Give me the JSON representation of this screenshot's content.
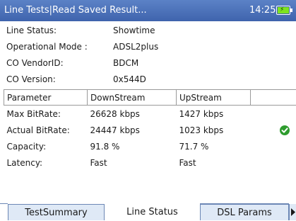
{
  "header": {
    "title": "Line Tests|Read Saved Result...",
    "time": "14:25",
    "icon": "battery-charging-icon"
  },
  "info": [
    {
      "label": "Line Status:",
      "value": "Showtime"
    },
    {
      "label": "Operational Mode :",
      "value": "ADSL2plus"
    },
    {
      "label": "CO VendorID:",
      "value": "BDCM"
    },
    {
      "label": "CO Version:",
      "value": "0x544D"
    }
  ],
  "table": {
    "headers": [
      "Parameter",
      "DownStream",
      "UpStream"
    ],
    "rows": [
      {
        "parameter": "Max BitRate:",
        "down": "26628  kbps",
        "up": "1427  kbps",
        "status": ""
      },
      {
        "parameter": "Actual BitRate:",
        "down": "24447  kbps",
        "up": "1023  kbps",
        "status": "check-icon"
      },
      {
        "parameter": "Capacity:",
        "down": "91.8  %",
        "up": "71.7  %",
        "status": ""
      },
      {
        "parameter": "Latency:",
        "down": "Fast",
        "up": "Fast",
        "status": ""
      }
    ]
  },
  "tabs": [
    {
      "label": "TestSummary",
      "active": false
    },
    {
      "label": "Line Status",
      "active": true
    },
    {
      "label": "DSL Params",
      "active": false
    }
  ],
  "colors": {
    "titlebar": "#4a70b8",
    "tab_inactive": "#dfe9f6",
    "ok_green": "#2e9c2e",
    "battery_green": "#7ee31e"
  }
}
